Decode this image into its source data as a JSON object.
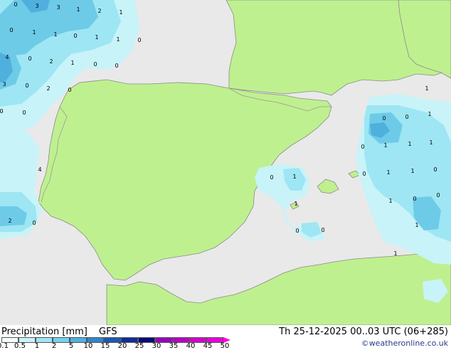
{
  "title": "Precipitation [mm]",
  "model": "GFS",
  "valid_time": "Th 25-12-2025 00..03 UTC (06+285)",
  "credit": "©weatheronline.co.uk",
  "colors": {
    "sea": "#e9e9e9",
    "land": "#bff08f",
    "border": "#9a9a9a",
    "coast": "#8a8a8a",
    "precip_light": "#c8f3f9",
    "precip_mid": "#9ee6f3",
    "precip_heavy": "#6dcbe8",
    "precip_core": "#4fb0de"
  },
  "legend": {
    "labels": [
      "0.1",
      "0.5",
      "1",
      "2",
      "5",
      "10",
      "15",
      "20",
      "25",
      "30",
      "35",
      "40",
      "45",
      "50"
    ],
    "colors": [
      "#f4fdfe",
      "#c8f3f9",
      "#9ee6f3",
      "#74d2ed",
      "#4fb0de",
      "#2f86cc",
      "#1c56b8",
      "#102d98",
      "#0a0a74",
      "#9a00bf",
      "#b800c8",
      "#d400d0",
      "#e800dc",
      "#ff00e6"
    ]
  },
  "grid_values": [
    {
      "label": "0",
      "id": "v1"
    },
    {
      "label": "3",
      "id": "v2"
    },
    {
      "label": "3",
      "id": "v3"
    },
    {
      "label": "1",
      "id": "v4"
    },
    {
      "label": "2",
      "id": "v5"
    },
    {
      "label": "1",
      "id": "v6"
    },
    {
      "label": "0",
      "id": "v7"
    },
    {
      "label": "1",
      "id": "v8"
    },
    {
      "label": "1",
      "id": "v9"
    },
    {
      "label": "0",
      "id": "v10"
    },
    {
      "label": "1",
      "id": "v11"
    },
    {
      "label": "1",
      "id": "v12"
    },
    {
      "label": "0",
      "id": "v13"
    },
    {
      "label": "4",
      "id": "v14"
    },
    {
      "label": "0",
      "id": "v15"
    },
    {
      "label": "2",
      "id": "v16"
    },
    {
      "label": "1",
      "id": "v17"
    },
    {
      "label": "0",
      "id": "v18"
    },
    {
      "label": "0",
      "id": "v19"
    },
    {
      "label": "3",
      "id": "v20"
    },
    {
      "label": "0",
      "id": "v21"
    },
    {
      "label": "2",
      "id": "v22"
    },
    {
      "label": "0",
      "id": "v23"
    },
    {
      "label": "0",
      "id": "v24"
    },
    {
      "label": "0",
      "id": "v25"
    },
    {
      "label": "4",
      "id": "v26"
    },
    {
      "label": "2",
      "id": "v27"
    },
    {
      "label": "0",
      "id": "v28"
    },
    {
      "label": "1",
      "id": "v29"
    },
    {
      "label": "0",
      "id": "v30"
    },
    {
      "label": "0",
      "id": "v31"
    },
    {
      "label": "1",
      "id": "v32"
    },
    {
      "label": "0",
      "id": "v33"
    },
    {
      "label": "1",
      "id": "v34"
    },
    {
      "label": "1",
      "id": "v35"
    },
    {
      "label": "1",
      "id": "v36"
    },
    {
      "label": "0",
      "id": "v37"
    },
    {
      "label": "1",
      "id": "v38"
    },
    {
      "label": "1",
      "id": "v39"
    },
    {
      "label": "0",
      "id": "v40"
    },
    {
      "label": "0",
      "id": "v41"
    },
    {
      "label": "1",
      "id": "v42"
    },
    {
      "label": "1",
      "id": "v43"
    },
    {
      "label": "0",
      "id": "v44"
    },
    {
      "label": "1",
      "id": "v45"
    },
    {
      "label": "0",
      "id": "v46"
    },
    {
      "label": "1",
      "id": "v47"
    },
    {
      "label": "0",
      "id": "v48"
    },
    {
      "label": "0",
      "id": "v49"
    },
    {
      "label": "1",
      "id": "v50"
    }
  ]
}
